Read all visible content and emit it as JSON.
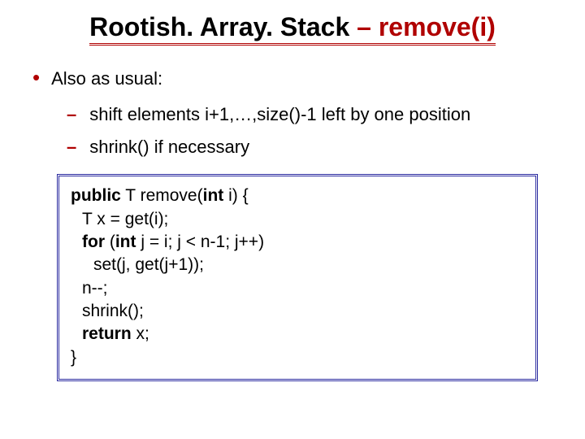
{
  "title": {
    "part1": "Rootish. Array. Stack",
    "dash": " – ",
    "part2": "remove(i)"
  },
  "bullet1": "Also as usual:",
  "sub1": {
    "pre": "shift elements ",
    "mid": "i+1,…,size()-1",
    "post": " left by one position"
  },
  "sub2": {
    "pre": "",
    "mid": "shrink()",
    "post": " if necessary"
  },
  "code": {
    "l1a": "public",
    "l1b": " T remove(",
    "l1c": "int",
    "l1d": " i) {",
    "l2": "T x = get(i);",
    "l3a": "for",
    "l3b": " (",
    "l3c": "int",
    "l3d": " j = i; j < n-1; j++)",
    "l4": "set(j, get(j+1));",
    "l5": "n--;",
    "l6": "shrink();",
    "l7a": "return",
    "l7b": " x;",
    "l8": "}"
  }
}
